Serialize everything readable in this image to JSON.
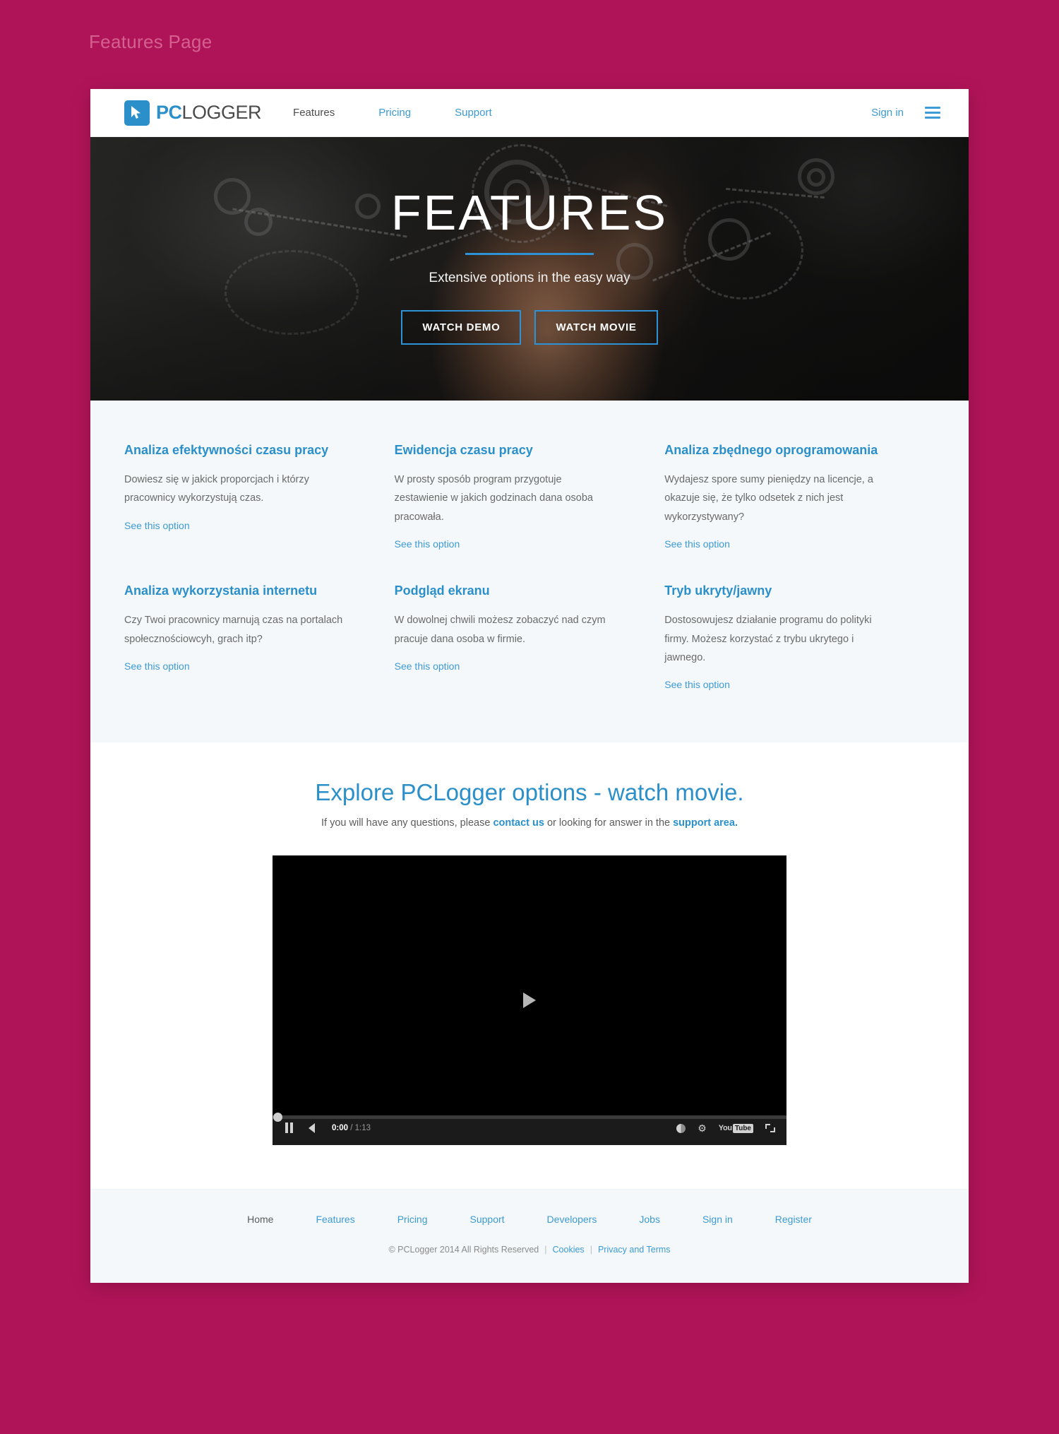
{
  "page_label": "Features Page",
  "brand": {
    "pc": "PC",
    "logger": "LOGGER",
    "icon": "cursor-arrow-icon",
    "color": "#2b8fca"
  },
  "navbar": {
    "links": [
      {
        "label": "Features",
        "active": true
      },
      {
        "label": "Pricing",
        "active": false
      },
      {
        "label": "Support",
        "active": false
      }
    ],
    "signin_label": "Sign in",
    "menu_icon": "hamburger-menu-icon"
  },
  "hero": {
    "title": "FEATURES",
    "subtitle": "Extensive options in the easy way",
    "buttons": [
      {
        "label": "WATCH DEMO"
      },
      {
        "label": "WATCH MOVIE"
      }
    ],
    "accent_color": "#2e93d6"
  },
  "features": {
    "link_label": "See this option",
    "items": [
      {
        "title": "Analiza efektywności czasu pracy",
        "desc": "Dowiesz się w jakick proporcjach i którzy pracownicy wykorzystują czas.",
        "link": "See this option"
      },
      {
        "title": "Ewidencja czasu pracy",
        "desc": "W prosty sposób program przygotuje zestawienie w jakich godzinach dana osoba pracowała.",
        "link": "See this option"
      },
      {
        "title": "Analiza zbędnego oprogramowania",
        "desc": "Wydajesz spore sumy pieniędzy na licencje, a okazuje się, że tylko odsetek z nich jest wykorzystywany?",
        "link": "See this option"
      },
      {
        "title": "Analiza wykorzystania internetu",
        "desc": "Czy Twoi pracownicy marnują czas na portalach społecznościowcyh, grach itp?",
        "link": "See this option"
      },
      {
        "title": "Podgląd ekranu",
        "desc": "W dowolnej chwili możesz zobaczyć nad czym pracuje dana osoba w firmie.",
        "link": "See this option"
      },
      {
        "title": "Tryb ukryty/jawny",
        "desc": "Dostosowujesz działanie programu do polityki firmy. Możesz korzystać z trybu ukrytego i jawnego.",
        "link": "See this option"
      }
    ]
  },
  "movie": {
    "title": "Explore PCLogger options - watch movie.",
    "sub_part1": "If you will have any questions, please ",
    "sub_link1": "contact us",
    "sub_part2": " or looking for answer in the ",
    "sub_link2": "support area.",
    "player": {
      "current_time": "0:00",
      "separator": " / ",
      "duration": "1:13",
      "play_icon": "play-triangle-icon",
      "pause_icon": "pause-icon",
      "volume_icon": "volume-icon",
      "info_icon": "info-icon",
      "settings_icon": "gear-icon",
      "brand": "YouTube",
      "brand_you": "You",
      "brand_tube": "Tube",
      "fullscreen_icon": "fullscreen-icon"
    }
  },
  "footer": {
    "nav": [
      {
        "label": "Home",
        "active": true
      },
      {
        "label": "Features",
        "active": false
      },
      {
        "label": "Pricing",
        "active": false
      },
      {
        "label": "Support",
        "active": false
      },
      {
        "label": "Developers",
        "active": false
      },
      {
        "label": "Jobs",
        "active": false
      },
      {
        "label": "Sign in",
        "active": false
      },
      {
        "label": "Register",
        "active": false
      }
    ],
    "copyright": "© PCLogger 2014  All Rights Reserved",
    "cookies": "Cookies",
    "privacy": "Privacy and Terms",
    "sep": "|"
  }
}
